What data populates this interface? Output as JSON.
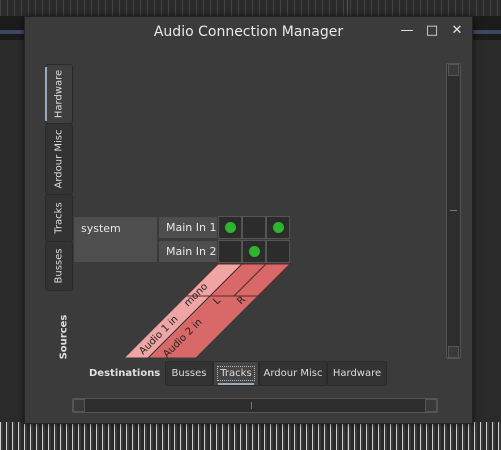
{
  "window": {
    "title": "Audio Connection Manager",
    "minimize_glyph": "—",
    "maximize_glyph": "□",
    "close_glyph": "✕"
  },
  "source_tabs": [
    {
      "label": "Hardware",
      "active": true
    },
    {
      "label": "Ardour Misc",
      "active": false
    },
    {
      "label": "Tracks",
      "active": false
    },
    {
      "label": "Busses",
      "active": false
    }
  ],
  "sources_label": "Sources",
  "matrix": {
    "group": "system",
    "ports": [
      "Main In 1",
      "Main In 2"
    ],
    "connections": [
      [
        true,
        false,
        true
      ],
      [
        false,
        true,
        false
      ]
    ],
    "destination_tracks": [
      {
        "name": "Audio 1 in",
        "channels": [
          "mono"
        ]
      },
      {
        "name": "Audio 2 in",
        "channels": [
          "L",
          "R"
        ]
      }
    ]
  },
  "destinations_label": "Destinations",
  "destination_tabs": [
    {
      "label": "Busses",
      "active": false
    },
    {
      "label": "Tracks",
      "active": true
    },
    {
      "label": "Ardour Misc",
      "active": false
    },
    {
      "label": "Hardware",
      "active": false
    }
  ],
  "colors": {
    "connection_dot": "#2db52d",
    "track_band": "#d96868",
    "track_band_light": "#f0a5a5"
  }
}
